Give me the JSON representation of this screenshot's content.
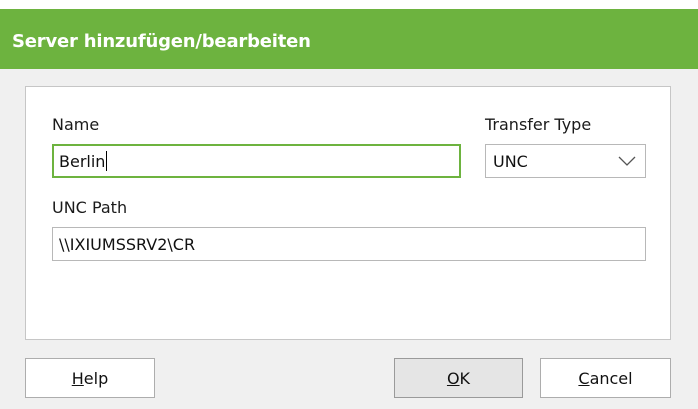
{
  "dialog": {
    "title": "Server hinzufügen/bearbeiten"
  },
  "form": {
    "name_label": "Name",
    "name_value": "Berlin",
    "transfer_type_label": "Transfer Type",
    "transfer_type_value": "UNC",
    "unc_path_label": "UNC Path",
    "unc_path_value": "\\\\IXIUMSSRV2\\CR"
  },
  "buttons": {
    "help": {
      "mnemonic": "H",
      "rest": "elp"
    },
    "ok": {
      "mnemonic": "O",
      "rest": "K"
    },
    "cancel": {
      "mnemonic": "C",
      "rest": "ancel"
    }
  },
  "colors": {
    "accent": "#6db33f",
    "title_text": "#ffffff",
    "background": "#f0f0f0"
  }
}
